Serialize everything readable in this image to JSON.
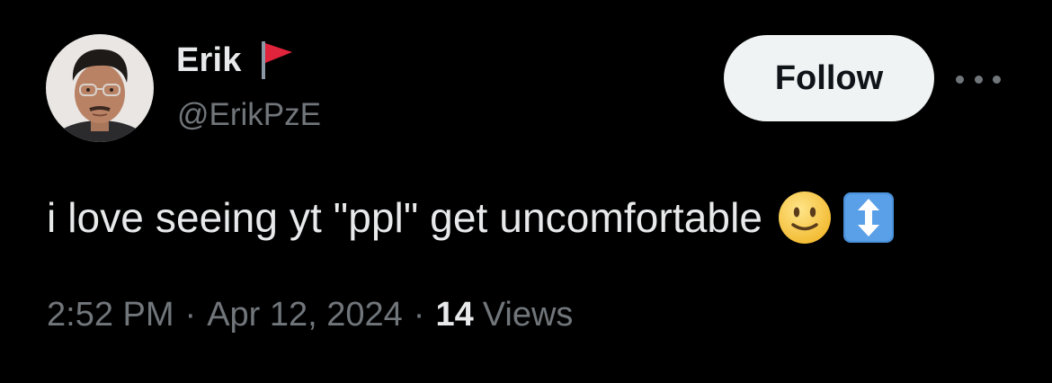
{
  "author": {
    "display_name": "Erik",
    "handle": "@ErikPzE",
    "badge_icon": "red-flag-icon",
    "avatar": "profile-photo"
  },
  "actions": {
    "follow_label": "Follow",
    "more_icon": "more-horizontal-icon"
  },
  "tweet": {
    "text": "i love seeing yt \"ppl\" get uncomfortable",
    "emojis": [
      "slightly-smiling-face",
      "up-down-arrow"
    ]
  },
  "meta": {
    "time": "2:52 PM",
    "separator": "·",
    "date": "Apr 12, 2024",
    "views_count": "14",
    "views_label": "Views"
  },
  "colors": {
    "background": "#000000",
    "primary_text": "#e7e9ea",
    "secondary_text": "#71767b",
    "follow_bg": "#eff3f4",
    "follow_text": "#0f1419",
    "flag_red": "#e0243c",
    "emoji_yellow": "#f7c93b",
    "arrow_blue": "#4a90d9"
  }
}
